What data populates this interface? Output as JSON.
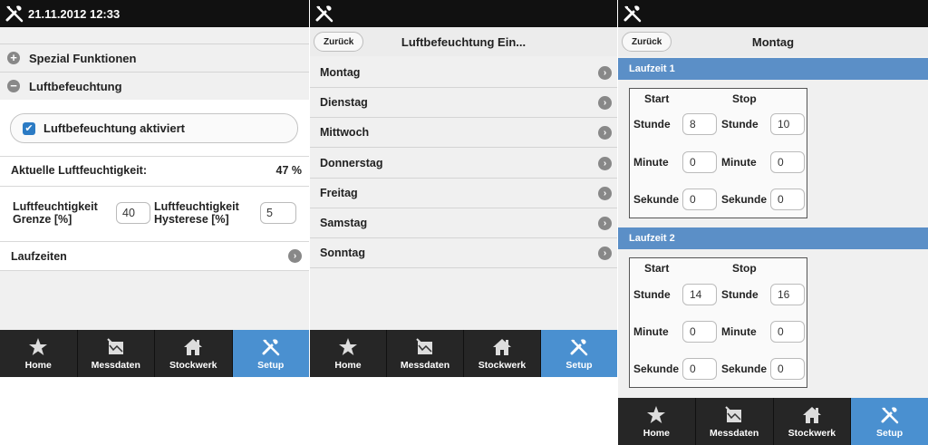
{
  "panel1": {
    "datetime": "21.11.2012 12:33",
    "collapsible_1": {
      "label": "Spezial Funktionen",
      "icon": "plus-icon"
    },
    "collapsible_2": {
      "label": "Luftbefeuchtung",
      "icon": "minus-icon"
    },
    "checkbox_label": "Luftbefeuchtung aktiviert",
    "humidity_label": "Aktuelle Luftfeuchtigkeit:",
    "humidity_value": "47 %",
    "limit_label_1": "Luftfeuchtigkeit",
    "limit_label_2": "Grenze [%]",
    "limit_value": "40",
    "hyst_label_1": "Luftfeuchtigkeit",
    "hyst_label_2": "Hysterese [%]",
    "hyst_value": "5",
    "laufzeiten_label": "Laufzeiten"
  },
  "panel2": {
    "back_label": "Zurück",
    "title": "Luftbefeuchtung Ein...",
    "days": [
      "Montag",
      "Dienstag",
      "Mittwoch",
      "Donnerstag",
      "Freitag",
      "Samstag",
      "Sonntag"
    ]
  },
  "panel3": {
    "back_label": "Zurück",
    "title": "Montag",
    "col_start": "Start",
    "col_stop": "Stop",
    "row_labels": {
      "hour": "Stunde",
      "minute": "Minute",
      "second": "Sekunde"
    },
    "laufzeit1": {
      "label": "Laufzeit 1",
      "start_h": "8",
      "stop_h": "10",
      "start_m": "0",
      "stop_m": "0",
      "start_s": "0",
      "stop_s": "0"
    },
    "laufzeit2": {
      "label": "Laufzeit 2",
      "start_h": "14",
      "stop_h": "16",
      "start_m": "0",
      "stop_m": "0",
      "start_s": "0",
      "stop_s": "0"
    }
  },
  "nav": {
    "home": "Home",
    "messdaten": "Messdaten",
    "stockwerk": "Stockwerk",
    "setup": "Setup"
  },
  "colors": {
    "active_nav": "#4a90d0",
    "section_header": "#5b8fc7",
    "checkbox": "#2b7bc4",
    "topbar": "#111111"
  }
}
